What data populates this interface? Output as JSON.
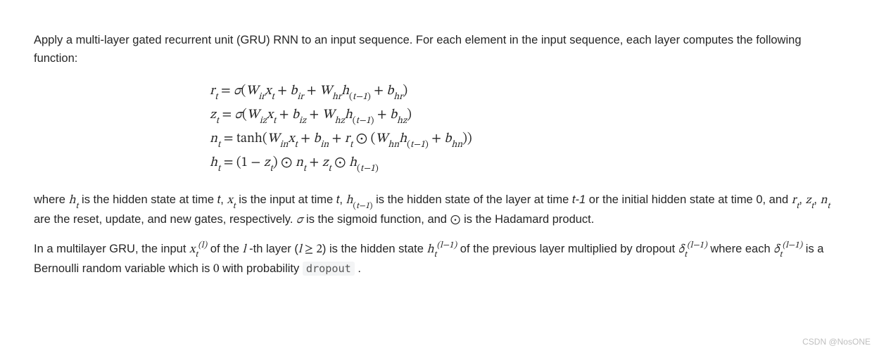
{
  "intro": "Apply a multi-layer gated recurrent unit (GRU) RNN to an input sequence. For each element in the input sequence, each layer computes the following function:",
  "equations": {
    "r": "r_t = σ(W_{ir} x_t + b_{ir} + W_{hr} h_{(t-1)} + b_{hr})",
    "z": "z_t = σ(W_{iz} x_t + b_{iz} + W_{hz} h_{(t-1)} + b_{hz})",
    "n": "n_t = tanh(W_{in} x_t + b_{in} + r_t ⊙ (W_{hn} h_{(t-1)} + b_{hn}))",
    "h": "h_t = (1 − z_t) ⊙ n_t + z_t ⊙ h_{(t-1)}"
  },
  "desc": {
    "where": "where ",
    "ht": "h_t",
    "seg1": " is the hidden state at time ",
    "t": "t",
    "seg2": ", ",
    "xt": "x_t",
    "seg3": " is the input at time ",
    "seg4": ", ",
    "htm1": "h_{(t-1)}",
    "seg5": " is the hidden state of the layer at time ",
    "tm1": "t-1",
    "seg6": " or the initial hidden state at time 0, and ",
    "rt": "r_t",
    "seg7": ", ",
    "zt": "z_t",
    "seg8": ", ",
    "nt": "n_t",
    "seg9": " are the reset, update, and new gates, respectively. ",
    "sigma": "σ",
    "seg10": " is the sigmoid function, and ",
    "odot": "⊙",
    "seg11": " is the Hadamard product."
  },
  "multilayer": {
    "seg1": "In a multilayer GRU, the input ",
    "xtl": "x_t^{(l)}",
    "seg2": " of the ",
    "l": "l",
    "seg3": " -th layer (",
    "cond": "l ≥ 2",
    "seg4": ") is the hidden state ",
    "htlm1": "h_t^{(l-1)}",
    "seg5": " of the previous layer multiplied by dropout ",
    "deltalm1a": "δ_t^{(l-1)}",
    "seg6": " where each ",
    "deltalm1b": "δ_t^{(l-1)}",
    "seg7": " is a Bernoulli random variable which is ",
    "zero": "0",
    "seg8": " with probability ",
    "kw": "dropout",
    "seg9": " ."
  },
  "watermark": "CSDN @NosONE"
}
